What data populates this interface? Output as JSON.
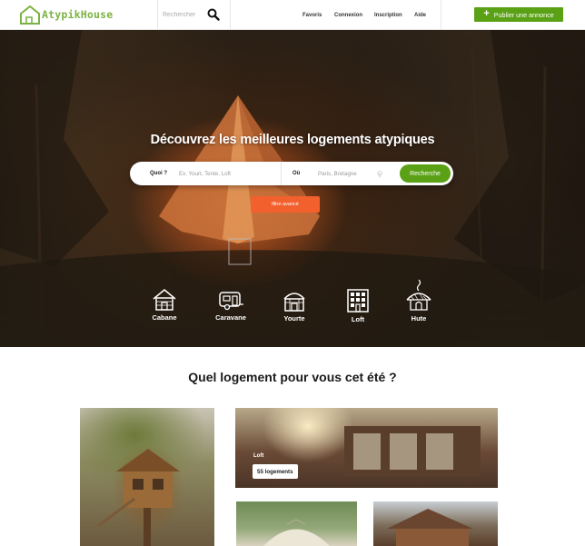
{
  "header": {
    "logo_text": "AtypikHouse",
    "search_placeholder": "Rechercher",
    "nav": {
      "favoris": "Favoris",
      "connexion": "Connexion",
      "inscription": "Inscription",
      "aide": "Aide"
    },
    "publish_label": "Publier une annonce"
  },
  "hero": {
    "title": "Découvrez les meilleures logements atypiques",
    "search": {
      "what_label": "Quoi ?",
      "what_placeholder": "Ex. Yourt, Tente, Loft",
      "where_label": "Où",
      "where_placeholder": "Paris, Bretagne",
      "button_label": "Recherche"
    },
    "filter_label": "filtre avancé",
    "categories": [
      {
        "label": "Cabane",
        "icon": "cabin-icon"
      },
      {
        "label": "Caravane",
        "icon": "caravan-icon"
      },
      {
        "label": "Yourte",
        "icon": "yurt-icon"
      },
      {
        "label": "Loft",
        "icon": "loft-icon"
      },
      {
        "label": "Hute",
        "icon": "hut-icon"
      }
    ]
  },
  "section": {
    "title": "Quel logement pour vous cet été ?",
    "featured": {
      "label": "Loft",
      "count": "55 logements"
    }
  },
  "colors": {
    "brand_green": "#5aa116",
    "logo_green": "#7cb342",
    "filter_orange": "#f2602e"
  }
}
